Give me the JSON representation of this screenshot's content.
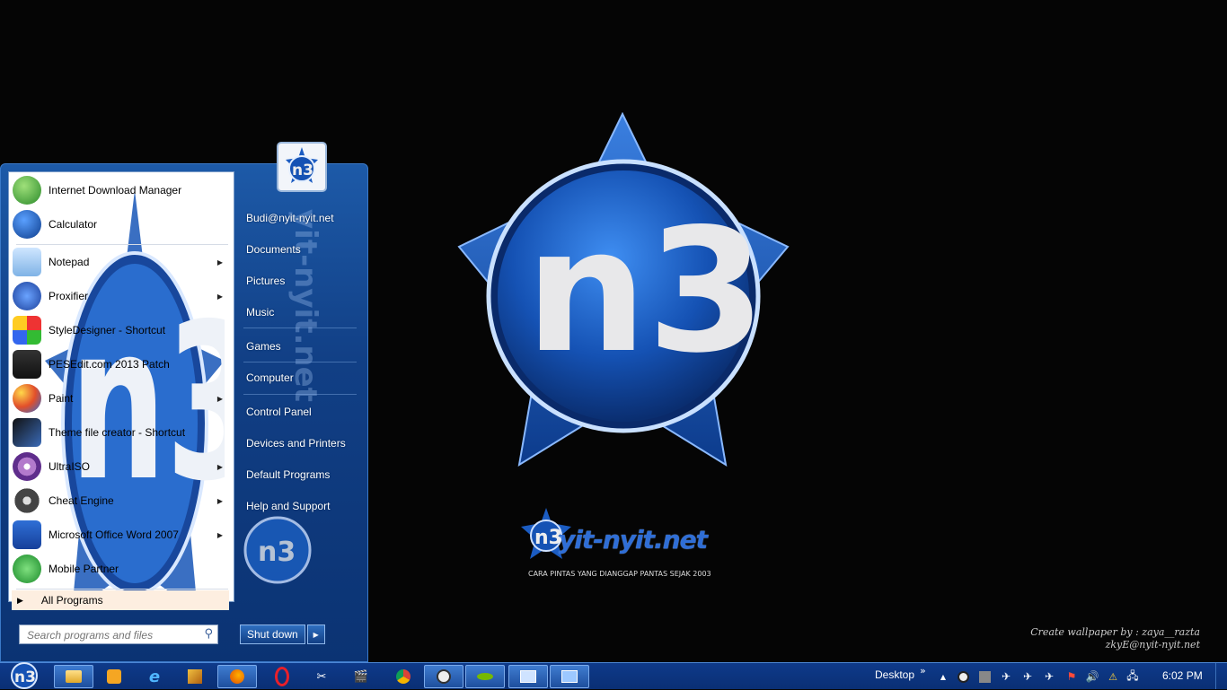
{
  "wallpaper": {
    "logo_text": "n3",
    "brand_name": "yit-nyit.net",
    "tagline": "CARA PINTAS YANG DIANGGAP PANTAS SEJAK 2003",
    "credit_line1": "Create wallpaper by : zaya__razta",
    "credit_line2": "zkyE@nyit-nyit.net",
    "accent_color": "#1f63c6"
  },
  "start_menu": {
    "programs": [
      {
        "label": "Internet Download Manager",
        "icon": "idm-globe-icon",
        "has_submenu": false
      },
      {
        "label": "Calculator",
        "icon": "n3-calculator-icon",
        "has_submenu": false
      },
      {
        "label": "Notepad",
        "icon": "notepad-icon",
        "has_submenu": true
      },
      {
        "label": "Proxifier",
        "icon": "proxifier-icon",
        "has_submenu": true
      },
      {
        "label": "StyleDesigner - Shortcut",
        "icon": "styledesigner-icon",
        "has_submenu": false
      },
      {
        "label": "PESEdit.com 2013 Patch",
        "icon": "pesedit-icon",
        "has_submenu": false
      },
      {
        "label": "Paint",
        "icon": "paint-icon",
        "has_submenu": true
      },
      {
        "label": "Theme file creator - Shortcut",
        "icon": "theme-creator-icon",
        "has_submenu": false
      },
      {
        "label": "UltraISO",
        "icon": "ultraiso-disc-icon",
        "has_submenu": true
      },
      {
        "label": "Cheat Engine",
        "icon": "cheat-engine-gear-icon",
        "has_submenu": true
      },
      {
        "label": "Microsoft Office Word 2007",
        "icon": "word-icon",
        "has_submenu": true
      },
      {
        "label": "Mobile Partner",
        "icon": "mobile-partner-icon",
        "has_submenu": false
      }
    ],
    "all_programs_label": "All Programs",
    "search_placeholder": "Search programs and files",
    "user_name": "Budi@nyit-nyit.net",
    "places": [
      "Documents",
      "Pictures",
      "Music",
      "Games",
      "Computer",
      "Control Panel",
      "Devices and Printers",
      "Default Programs",
      "Help and Support"
    ],
    "shutdown_label": "Shut down"
  },
  "taskbar": {
    "start_logo": "n3",
    "pinned": [
      "explorer-folder-icon",
      "media-player-icon",
      "internet-explorer-icon",
      "photo-viewer-icon",
      "firefox-icon",
      "opera-icon",
      "snipping-tool-icon",
      "movie-maker-icon",
      "chrome-icon",
      "n3-app-icon",
      "nvidia-icon",
      "remote-monitor-icon",
      "network-manager-icon"
    ],
    "desktop_toolbar_label": "Desktop",
    "desktop_chevron": "»",
    "tray_icons": [
      "show-hidden-icon",
      "app-tray-icon",
      "square-tray-icon",
      "bird-tray-icon",
      "bird-tray-icon-2",
      "bird-tray-icon-3",
      "action-center-flag-icon",
      "volume-icon",
      "network-warning-icon",
      "language-icon"
    ],
    "clock": "6:02 PM"
  }
}
